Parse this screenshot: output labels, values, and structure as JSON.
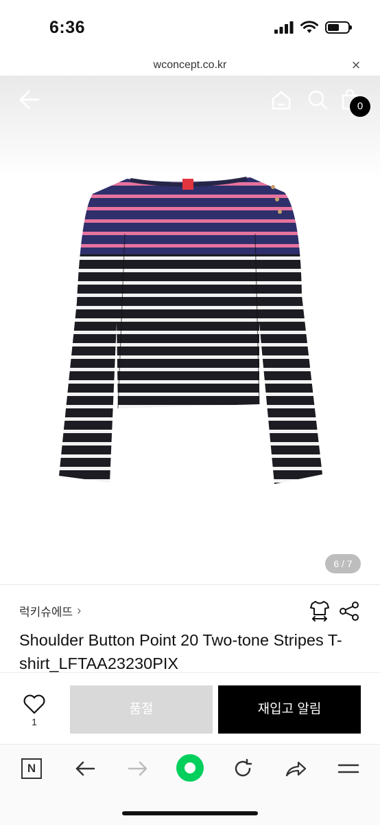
{
  "status_bar": {
    "time": "6:36"
  },
  "browser": {
    "url": "wconcept.co.kr",
    "close_label": "×"
  },
  "header": {
    "cart_count": "0"
  },
  "gallery": {
    "counter": "6 / 7"
  },
  "product": {
    "brand": "럭키슈에뜨",
    "brand_chevron": "›",
    "title": "Shoulder Button Point 20 Two-tone Stripes T-shirt_LFTAA23230PIX"
  },
  "actions": {
    "like_count": "1",
    "soldout_label": "품절",
    "restock_label": "재입고 알림"
  },
  "toolbar": {
    "naver_letter": "N"
  },
  "colors": {
    "accent_green": "#03cf5d",
    "navy_stripe": "#2e2f6b",
    "pink_stripe": "#e6739e",
    "body_black": "#1c1c22"
  }
}
